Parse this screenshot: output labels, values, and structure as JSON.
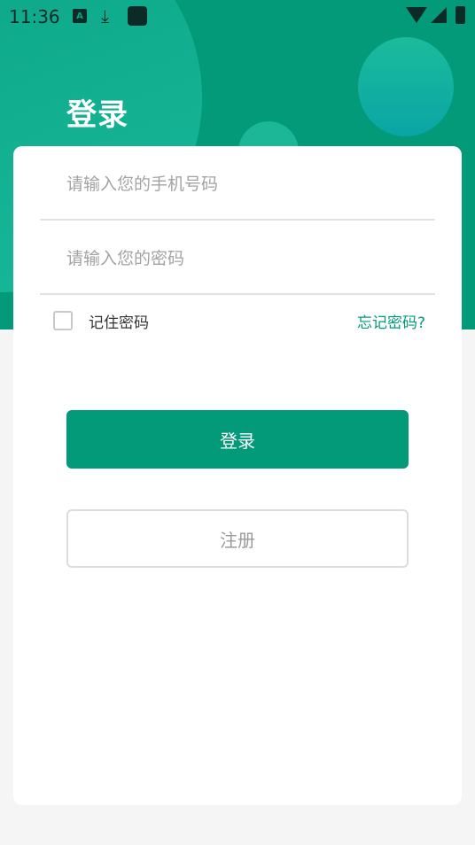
{
  "status_bar": {
    "time": "11:36",
    "icons": [
      "a-notification-icon",
      "download-icon",
      "app-square-icon",
      "wifi-icon",
      "signal-icon",
      "battery-icon"
    ]
  },
  "header": {
    "title": "登录",
    "background_color": "#039a79"
  },
  "form": {
    "phone": {
      "value": "",
      "placeholder": "请输入您的手机号码"
    },
    "password": {
      "value": "",
      "placeholder": "请输入您的密码"
    },
    "remember": {
      "label": "记住密码",
      "checked": false
    },
    "forgot_label": "忘记密码?"
  },
  "buttons": {
    "login_label": "登录",
    "register_label": "注册"
  },
  "colors": {
    "accent": "#039a79",
    "card": "#ffffff",
    "page_bg": "#f5f5f5"
  }
}
